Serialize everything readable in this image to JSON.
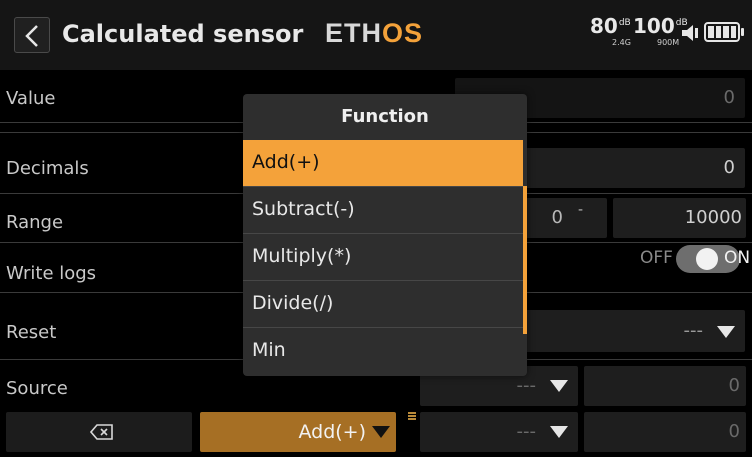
{
  "header": {
    "back_icon": "chevron-left-icon",
    "title": "Calculated sensor",
    "logo_text_main": "ETH",
    "logo_text_accent": "OS",
    "rssi_24": {
      "value": "80",
      "unit": "dB",
      "band": "2.4G"
    },
    "rssi_900": {
      "value": "100",
      "unit": "dB",
      "band": "900M"
    },
    "speaker_icon": "speaker-icon",
    "battery_icon": "battery-icon"
  },
  "rows": {
    "value": {
      "label": "Value",
      "value": "0"
    },
    "decimals": {
      "label": "Decimals",
      "value": "0"
    },
    "range": {
      "label": "Range",
      "min": "0",
      "separator": "-",
      "max": "10000"
    },
    "write_logs": {
      "label": "Write logs",
      "off_label": "OFF",
      "on_label": "ON",
      "state": "ON"
    },
    "reset": {
      "label": "Reset",
      "value": "---"
    },
    "source": {
      "label": "Source",
      "value1": "---",
      "value2": "0"
    },
    "formula": {
      "clear_icon": "backspace-icon",
      "function_value": "Add(+)",
      "value1": "---",
      "value2": "0"
    }
  },
  "modal": {
    "title": "Function",
    "options": [
      "Add(+)",
      "Subtract(-)",
      "Multiply(*)",
      "Divide(/)",
      "Min"
    ],
    "selected": "Add(+)"
  },
  "colors": {
    "accent": "#f4a23a",
    "background": "#000000",
    "panel": "#2e2e2e",
    "function_field": "#a66f24"
  }
}
